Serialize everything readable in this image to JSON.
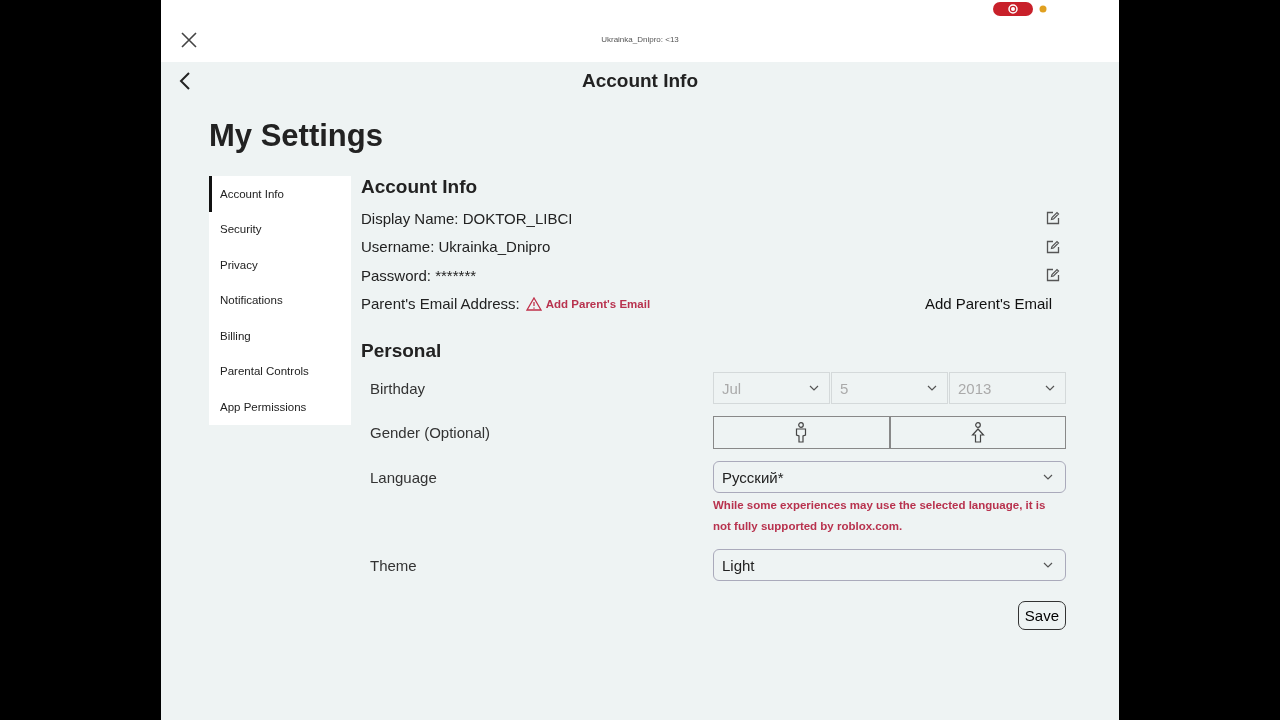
{
  "top_bar": {
    "title": "Ukrainka_Dnipro: <13",
    "recording": true
  },
  "header": {
    "title": "Account Info"
  },
  "page_title": "My Settings",
  "sidebar": {
    "items": [
      {
        "label": "Account Info",
        "selected": true
      },
      {
        "label": "Security",
        "selected": false
      },
      {
        "label": "Privacy",
        "selected": false
      },
      {
        "label": "Notifications",
        "selected": false
      },
      {
        "label": "Billing",
        "selected": false
      },
      {
        "label": "Parental Controls",
        "selected": false
      },
      {
        "label": "App Permissions",
        "selected": false
      }
    ]
  },
  "account_info": {
    "heading": "Account Info",
    "rows": [
      {
        "label": "Display Name: DOKTOR_LIBCI",
        "editable": true
      },
      {
        "label": "Username: Ukrainka_Dnipro",
        "editable": true
      },
      {
        "label": "Password: *******",
        "editable": true
      }
    ],
    "parent_email": {
      "label": "Parent's Email Address:",
      "warning": "Add Parent's Email",
      "action": "Add Parent's Email"
    }
  },
  "personal": {
    "heading": "Personal",
    "birthday": {
      "label": "Birthday",
      "disabled": true,
      "fields": [
        "Jul",
        "5",
        "2013"
      ]
    },
    "gender": {
      "label": "Gender (Optional)"
    },
    "language": {
      "label": "Language",
      "value": "Русский*",
      "note": "While some experiences may use the selected language, it is not fully supported by roblox.com."
    },
    "theme": {
      "label": "Theme",
      "value": "Light"
    },
    "save": "Save"
  }
}
